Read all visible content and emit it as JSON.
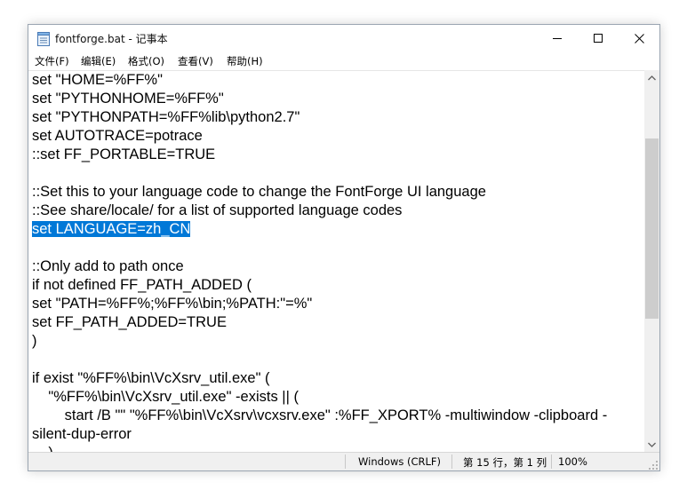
{
  "window": {
    "title": "fontforge.bat - 记事本",
    "icons": {
      "app": "notepad-icon",
      "minimize": "minimize-icon",
      "maximize": "maximize-icon",
      "close": "close-icon"
    }
  },
  "menu": {
    "items": [
      {
        "label": "文件(F)"
      },
      {
        "label": "编辑(E)"
      },
      {
        "label": "格式(O)"
      },
      {
        "label": "查看(V)"
      },
      {
        "label": "帮助(H)"
      }
    ]
  },
  "editor": {
    "lines": [
      "set \"HOME=%FF%\"",
      "set \"PYTHONHOME=%FF%\"",
      "set \"PYTHONPATH=%FF%lib\\python2.7\"",
      "set AUTOTRACE=potrace",
      "::set FF_PORTABLE=TRUE",
      "",
      "::Set this to your language code to change the FontForge UI language",
      "::See share/locale/ for a list of supported language codes",
      "set LANGUAGE=zh_CN",
      "",
      "::Only add to path once",
      "if not defined FF_PATH_ADDED (",
      "set \"PATH=%FF%;%FF%\\bin;%PATH:\"=%\"",
      "set FF_PATH_ADDED=TRUE",
      ")",
      "",
      "if exist \"%FF%\\bin\\VcXsrv_util.exe\" (",
      "    \"%FF%\\bin\\VcXsrv_util.exe\" -exists || (",
      "        start /B \"\" \"%FF%\\bin\\VcXsrv\\vcxsrv.exe\" :%FF_XPORT% -multiwindow -clipboard -",
      "silent-dup-error",
      "    )"
    ],
    "selected_line_index": 8,
    "selection_color": "#0078d7"
  },
  "status": {
    "encoding": "Windows (CRLF)",
    "position": "第 15 行，第 1 列",
    "zoom": "100%"
  }
}
